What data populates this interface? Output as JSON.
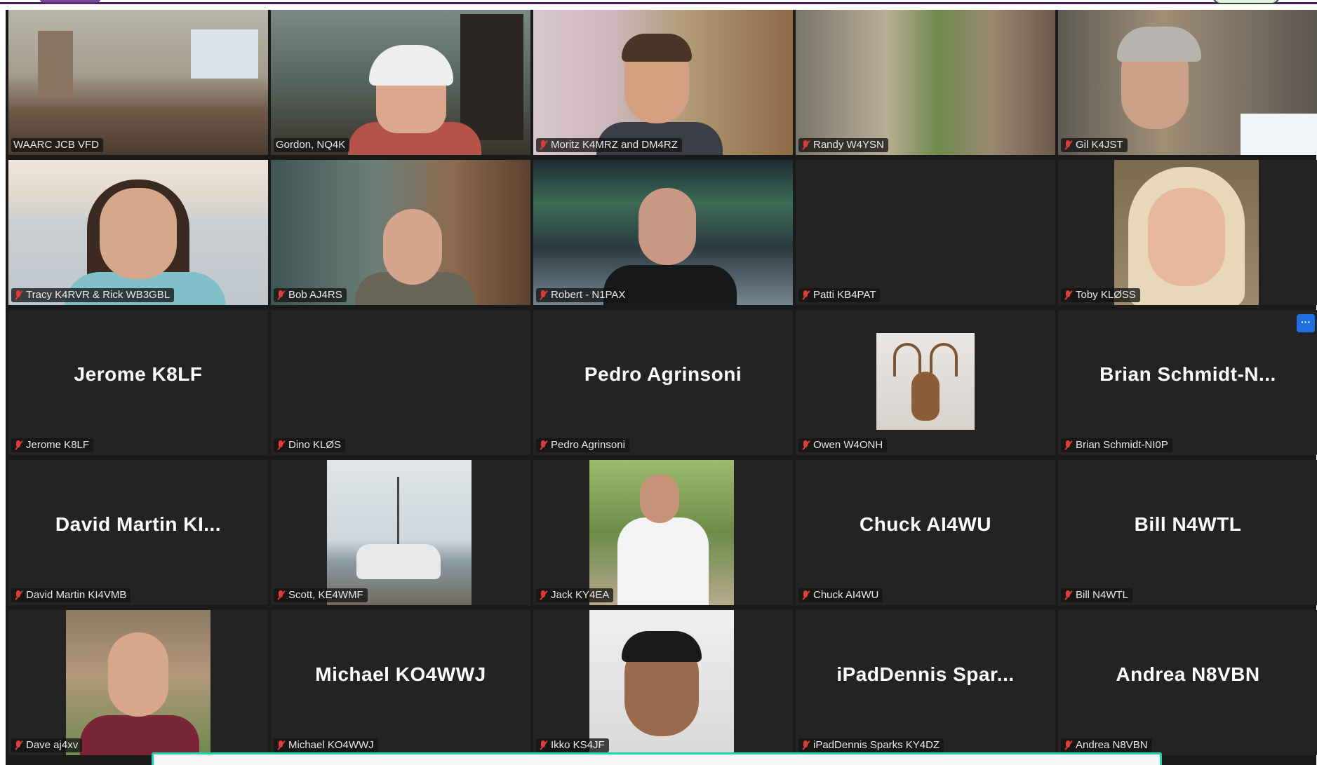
{
  "window": {
    "app": "zoom-gallery-view"
  },
  "gallery": {
    "tiles": [
      {
        "name": "WAARC JCB VFD",
        "muted": false
      },
      {
        "name": "Gordon, NQ4K",
        "muted": false,
        "active_speaker": true
      },
      {
        "name": "Moritz K4MRZ and DM4RZ",
        "muted": true
      },
      {
        "name": "Randy W4YSN",
        "muted": true
      },
      {
        "name": "Gil K4JST",
        "muted": true
      },
      {
        "name": "Tracy K4RVR & Rick WB3GBL",
        "muted": true
      },
      {
        "name": "Bob AJ4RS",
        "muted": true
      },
      {
        "name": "Robert - N1PAX",
        "muted": true
      },
      {
        "name": "Patti KB4PAT",
        "muted": true
      },
      {
        "name": "Toby KLØSS",
        "muted": true
      },
      {
        "name": "Jerome  K8LF",
        "display": "Jerome  K8LF",
        "muted": true
      },
      {
        "name": "Dino KLØS",
        "muted": true
      },
      {
        "name": "Pedro Agrinsoni",
        "display": "Pedro Agrinsoni",
        "muted": true
      },
      {
        "name": "Owen W4ONH",
        "muted": true
      },
      {
        "name": "Brian Schmidt-NI0P",
        "display": "Brian  Schmidt-N...",
        "muted": true
      },
      {
        "name": "David Martin KI4VMB",
        "display": "David Martin KI...",
        "muted": true
      },
      {
        "name": "Scott, KE4WMF",
        "muted": true
      },
      {
        "name": "Jack  KY4EA",
        "muted": true
      },
      {
        "name": "Chuck AI4WU",
        "display": "Chuck AI4WU",
        "muted": true
      },
      {
        "name": "Bill N4WTL",
        "display": "Bill N4WTL",
        "muted": true
      },
      {
        "name": "Dave aj4xv",
        "muted": true
      },
      {
        "name": "Michael KO4WWJ",
        "display": "Michael KO4WWJ",
        "muted": true
      },
      {
        "name": "Ikko KS4JF",
        "muted": true
      },
      {
        "name": "iPadDennis Sparks KY4DZ",
        "display": "iPadDennis  Spar...",
        "muted": true
      },
      {
        "name": "Andrea N8VBN",
        "display": "Andrea N8VBN",
        "muted": true
      }
    ],
    "more_label": "···"
  },
  "colors": {
    "active_outline": "#d6ea52",
    "muted_icon": "#e23b3b",
    "more_button": "#1f6fe0",
    "chat_border": "#1fd3a8"
  }
}
